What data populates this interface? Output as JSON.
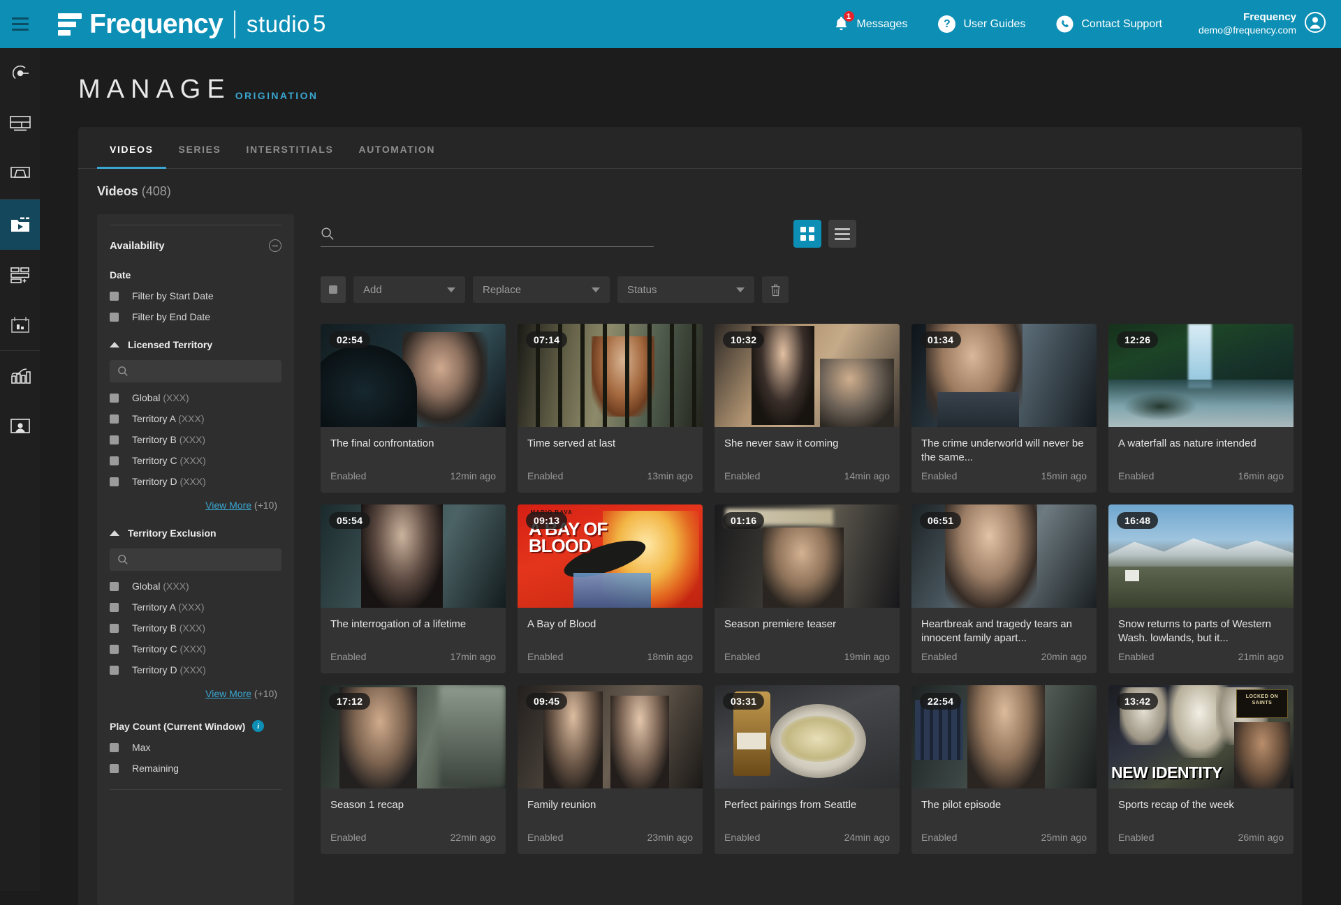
{
  "header": {
    "brand_name": "Frequency",
    "brand_studio": "studio",
    "brand_studio_five": "5",
    "messages_label": "Messages",
    "messages_badge": "1",
    "user_guides_label": "User Guides",
    "user_guides_icon_glyph": "?",
    "contact_support_label": "Contact Support",
    "account_name": "Frequency",
    "account_email": "demo@frequency.com",
    "accent_color": "#0d8fb5"
  },
  "rail": {
    "items": [
      {
        "name": "live-channel-icon"
      },
      {
        "name": "layouts-icon"
      },
      {
        "name": "display-icon"
      },
      {
        "name": "media-folder-icon"
      },
      {
        "name": "add-playlist-icon"
      },
      {
        "name": "schedule-icon"
      },
      {
        "name": "analytics-icon"
      },
      {
        "name": "audience-icon"
      }
    ]
  },
  "page": {
    "title": "MANAGE",
    "subtitle": "ORIGINATION"
  },
  "tabs": [
    {
      "label": "VIDEOS",
      "active": true
    },
    {
      "label": "SERIES",
      "active": false
    },
    {
      "label": "INTERSTITIALS",
      "active": false
    },
    {
      "label": "AUTOMATION",
      "active": false
    }
  ],
  "section": {
    "heading": "Videos",
    "count": "(408)"
  },
  "filters": {
    "availability_title": "Availability",
    "date_title": "Date",
    "date_options": [
      {
        "label": "Filter by Start Date"
      },
      {
        "label": "Filter by End Date"
      }
    ],
    "licensed_territory": {
      "title": "Licensed Territory",
      "search_placeholder": "",
      "options": [
        {
          "label": "Global",
          "count": "(XXX)"
        },
        {
          "label": "Territory A",
          "count": "(XXX)"
        },
        {
          "label": "Territory B",
          "count": "(XXX)"
        },
        {
          "label": "Territory C",
          "count": "(XXX)"
        },
        {
          "label": "Territory D",
          "count": "(XXX)"
        }
      ],
      "view_more": "View More",
      "view_more_count": "(+10)"
    },
    "territory_exclusion": {
      "title": "Territory Exclusion",
      "search_placeholder": "",
      "options": [
        {
          "label": "Global",
          "count": "(XXX)"
        },
        {
          "label": "Territory A",
          "count": "(XXX)"
        },
        {
          "label": "Territory B",
          "count": "(XXX)"
        },
        {
          "label": "Territory C",
          "count": "(XXX)"
        },
        {
          "label": "Territory D",
          "count": "(XXX)"
        }
      ],
      "view_more": "View More",
      "view_more_count": "(+10)"
    },
    "play_count": {
      "title": "Play Count (Current Window)",
      "info_glyph": "i",
      "options": [
        {
          "label": "Max"
        },
        {
          "label": "Remaining"
        }
      ]
    }
  },
  "toolbar": {
    "search_placeholder": "",
    "search_value": "",
    "grid_view_active": true,
    "list_view_active": false,
    "add_label": "Add",
    "replace_label": "Replace",
    "status_label": "Status"
  },
  "videos": [
    {
      "duration": "02:54",
      "title": "The final confrontation",
      "status": "Enabled",
      "updated": "12min ago",
      "thumb": "woman-dark-car"
    },
    {
      "duration": "07:14",
      "title": "Time served at last",
      "status": "Enabled",
      "updated": "13min ago",
      "thumb": "prison-bars"
    },
    {
      "duration": "10:32",
      "title": "She never saw it coming",
      "status": "Enabled",
      "updated": "14min ago",
      "thumb": "woman-man-street"
    },
    {
      "duration": "01:34",
      "title": "The crime underworld will never be the same...",
      "status": "Enabled",
      "updated": "15min ago",
      "thumb": "angry-man-suit"
    },
    {
      "duration": "12:26",
      "title": "A waterfall as nature intended",
      "status": "Enabled",
      "updated": "16min ago",
      "thumb": "waterfall"
    },
    {
      "duration": "05:54",
      "title": "The interrogation of a lifetime",
      "status": "Enabled",
      "updated": "17min ago",
      "thumb": "woman-interrogation"
    },
    {
      "duration": "09:13",
      "title": "A Bay of Blood",
      "status": "Enabled",
      "updated": "18min ago",
      "thumb": "bay-of-blood-poster"
    },
    {
      "duration": "01:16",
      "title": "Season premiere teaser",
      "status": "Enabled",
      "updated": "19min ago",
      "thumb": "man-corridor"
    },
    {
      "duration": "06:51",
      "title": "Heartbreak and tragedy tears an innocent family apart...",
      "status": "Enabled",
      "updated": "20min ago",
      "thumb": "woman-portrait"
    },
    {
      "duration": "16:48",
      "title": "Snow returns to parts of Western Wash. lowlands, but it...",
      "status": "Enabled",
      "updated": "21min ago",
      "thumb": "snow-mountains"
    },
    {
      "duration": "17:12",
      "title": "Season 1 recap",
      "status": "Enabled",
      "updated": "22min ago",
      "thumb": "man-outdoors"
    },
    {
      "duration": "09:45",
      "title": "Family reunion",
      "status": "Enabled",
      "updated": "23min ago",
      "thumb": "two-women-couch"
    },
    {
      "duration": "03:31",
      "title": "Perfect pairings from Seattle",
      "status": "Enabled",
      "updated": "24min ago",
      "thumb": "food-beer"
    },
    {
      "duration": "22:54",
      "title": "The pilot episode",
      "status": "Enabled",
      "updated": "25min ago",
      "thumb": "woman-office"
    },
    {
      "duration": "13:42",
      "title": "Sports recap of the week",
      "status": "Enabled",
      "updated": "26min ago",
      "thumb": "football-new-identity"
    }
  ]
}
